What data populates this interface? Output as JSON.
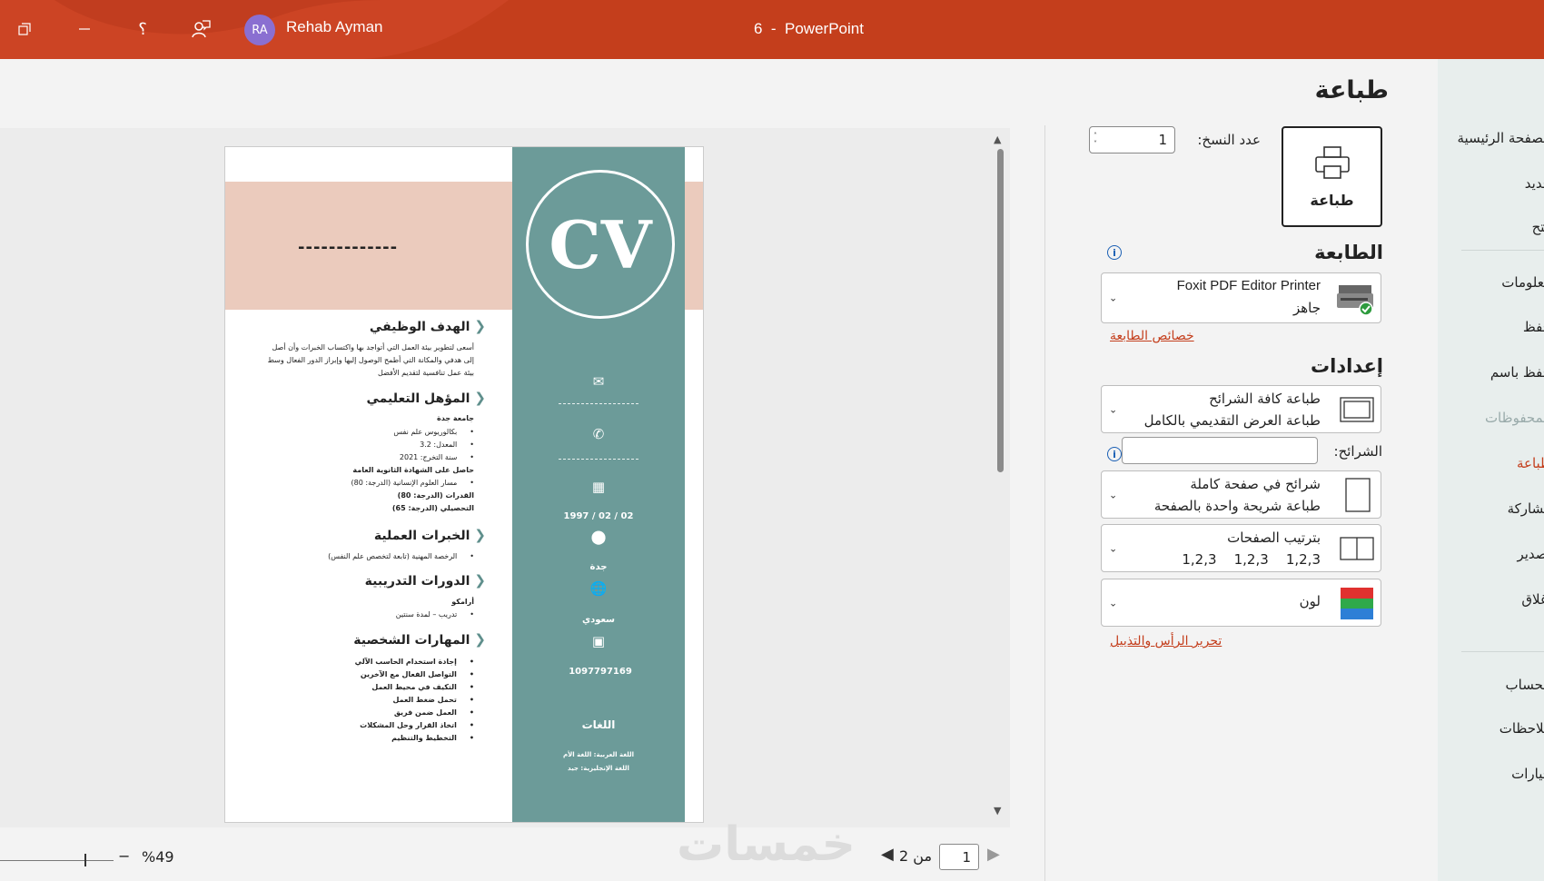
{
  "titlebar": {
    "user_initials": "RA",
    "user_name": "Rehab Ayman",
    "app_title": "6  -  PowerPoint"
  },
  "rail": {
    "items": [
      {
        "label": "الصفحة الرئيسية",
        "state": "normal"
      },
      {
        "label": "جديد",
        "state": "normal"
      },
      {
        "label": "فتح",
        "state": "normal"
      },
      {
        "label": "معلومات",
        "state": "normal"
      },
      {
        "label": "حفظ",
        "state": "normal"
      },
      {
        "label": "حفظ باسم",
        "state": "normal"
      },
      {
        "label": "المحفوظات",
        "state": "disabled"
      },
      {
        "label": "طباعة",
        "state": "active"
      },
      {
        "label": "مشاركة",
        "state": "normal"
      },
      {
        "label": "تصدير",
        "state": "normal"
      },
      {
        "label": "إغلاق",
        "state": "normal"
      },
      {
        "label": "الحساب",
        "state": "normal"
      },
      {
        "label": "ملاحظات",
        "state": "normal"
      },
      {
        "label": "خيارات",
        "state": "normal"
      }
    ]
  },
  "print": {
    "page_title": "طباعة",
    "print_button_label": "طباعة",
    "copies_label": "عدد النسخ:",
    "copies_value": "1",
    "printer_section": "الطابعة",
    "printer_name": "Foxit PDF Editor Printer",
    "printer_status": "جاهز",
    "printer_properties_link": "خصائص الطابعة",
    "settings_section": "إعدادات",
    "slides_range_title": "طباعة كافة الشرائح",
    "slides_range_desc": "طباعة العرض التقديمي بالكامل",
    "slides_label": "الشرائح:",
    "slides_value": "",
    "layout_title": "شرائح في صفحة كاملة",
    "layout_desc": "طباعة شريحة واحدة بالصفحة",
    "collate_title": "بترتيب الصفحات",
    "collate_desc": "1,2,3    1,2,3    1,2,3",
    "color_title": "لون",
    "header_footer_link": "تحرير الرأس والتذييل"
  },
  "preview": {
    "current_page": "1",
    "page_of": "من 2",
    "zoom": "%49"
  },
  "slide": {
    "cv_text": "CV",
    "name_placeholder": "-------------",
    "side": {
      "date": "1997 / 02 / 02",
      "city": "جدة",
      "nationality": "سعودي",
      "id_number": "1097797169",
      "languages_title": "اللغات",
      "lang_1": "اللغة العربية: اللغة الأم",
      "lang_2": "اللغة الإنجليزية: جيد"
    },
    "objective_title": "الهدف الوظيفي",
    "objective_text": "أسعى لتطوير بيئة العمل التي أتواجد بها واكتساب الخبرات وأن أصل إلى هدفي والمكانة التي أطمح الوصول إليها وإبراز الدور الفعال وسط بيئة عمل تنافسية لتقديم الأفضل",
    "education_title": "المؤهل التعليمي",
    "education_uni": "جامعة جدة",
    "education_items": [
      "بكالوريوس علم نفس",
      "المعدل: 3.2",
      "سنة التخرج: 2021"
    ],
    "education_highschool": "حاصل على الشهادة الثانوية العامة",
    "education_track": "مسار العلوم الإنسانية (الدرجة: 80)",
    "education_qudrat": "القدرات (الدرجة: 80)",
    "education_tahsili": "التحصيلي (الدرجة: 65)",
    "experience_title": "الخبرات العملية",
    "experience_items": [
      "الرخصة المهنية (تابعة لتخصص علم النفس)"
    ],
    "courses_title": "الدورات التدريبية",
    "courses_org": "أرامكو",
    "courses_items": [
      "تدريب – لمدة سنتين"
    ],
    "skills_title": "المهارات الشخصية",
    "skills_items": [
      "إجادة استخدام الحاسب الآلي",
      "التواصل الفعال مع الآخرين",
      "التكيف في محيط العمل",
      "تحمل ضغط العمل",
      "العمل ضمن فريق",
      "اتخاذ القرار وحل المشكلات",
      "التخطيط والتنظيم"
    ]
  },
  "watermark": "خمسات",
  "colors": {
    "accent": "#c43e1c",
    "slide_side": "#6c9b99",
    "slide_band": "#ebcbbd"
  }
}
